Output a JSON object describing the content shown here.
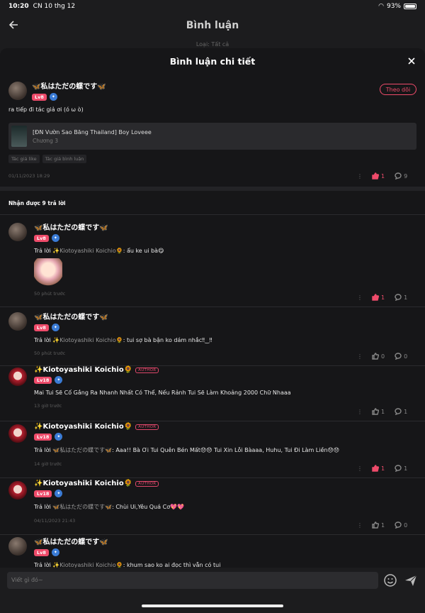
{
  "status_bar": {
    "time": "10:20",
    "date": "CN 10 thg 12",
    "battery": "93%"
  },
  "background_header": {
    "title": "Bình luận",
    "filter": "Loại: Tất cả"
  },
  "sheet": {
    "title": "Bình luận chi tiết"
  },
  "main_comment": {
    "username": "🦋私はただの蝶です🦋",
    "level": "Lv8",
    "follow_label": "Theo dõi",
    "text": "ra tiếp đi tác giả ơi (ó ω ò)",
    "book_title": "[ĐN Vườn Sao Băng Thailand] Boy Loveee",
    "book_chapter": "Chương 3",
    "chips": [
      "Tác giả like",
      "Tác giả bình luận"
    ],
    "date": "01/11/2023 18:29",
    "likes": "1",
    "replies": "9"
  },
  "replies_header": "Nhận được 9 trả lời",
  "replies": [
    {
      "username": "🦋私はただの蝶です🦋",
      "level": "Lv8",
      "author_tag": "",
      "prefix": "Trả lời ",
      "mention": "✨Kiotoyashiki Koichio🌻",
      "text": ": ẩu ke ui bà😋",
      "time": "50 phút trước",
      "likes": "1",
      "comments": "1",
      "has_sticker": true
    },
    {
      "username": "🦋私はただの蝶です🦋",
      "level": "Lv8",
      "author_tag": "",
      "prefix": "Trả lời ",
      "mention": "✨Kiotoyashiki Koichio🌻",
      "text": ": tui sợ bà bận ko dám nhắc‼︎‿‼︎",
      "time": "50 phút trước",
      "likes": "0",
      "comments": "0"
    },
    {
      "username": "✨Kiotoyashiki Koichio🌻",
      "level": "Lv18",
      "author_tag": "AUTHOR",
      "prefix": "",
      "mention": "",
      "text": "Mai Tui Sẽ Cố Gắng Ra Nhanh Nhất Có Thể, Nếu Rảnh Tui Sẽ Làm Khoảng 2000 Chữ Nhaaa",
      "time": "13 giờ trước",
      "likes": "1",
      "comments": "1"
    },
    {
      "username": "✨Kiotoyashiki Koichio🌻",
      "level": "Lv18",
      "author_tag": "AUTHOR",
      "prefix": "Trả lời ",
      "mention": "🦋私はただの蝶です🦋",
      "text": ": Aaa!! Bà Ơi Tui Quên Bén Mất😞😞 Tui Xin Lỗi Bàaaa, Huhu, Tui Đi Làm Liền😞😞",
      "time": "14 giờ trước",
      "likes": "1",
      "comments": "1"
    },
    {
      "username": "✨Kiotoyashiki Koichio🌻",
      "level": "Lv18",
      "author_tag": "AUTHOR",
      "prefix": "Trả lời ",
      "mention": "🦋私はただの蝶です🦋",
      "text": ": Chùi Ui,Yêu Quá Cơ💖💖",
      "time": "04/11/2023 21:43",
      "likes": "1",
      "comments": "0"
    },
    {
      "username": "🦋私はただの蝶です🦋",
      "level": "Lv8",
      "author_tag": "",
      "prefix": "Trả lời ",
      "mention": "✨Kiotoyashiki Koichio🌻",
      "text": ": khum sao ko ai đọc thì vẫn có tui",
      "time": "",
      "likes": "",
      "comments": ""
    }
  ],
  "input": {
    "placeholder": "Viết gì đó~"
  }
}
